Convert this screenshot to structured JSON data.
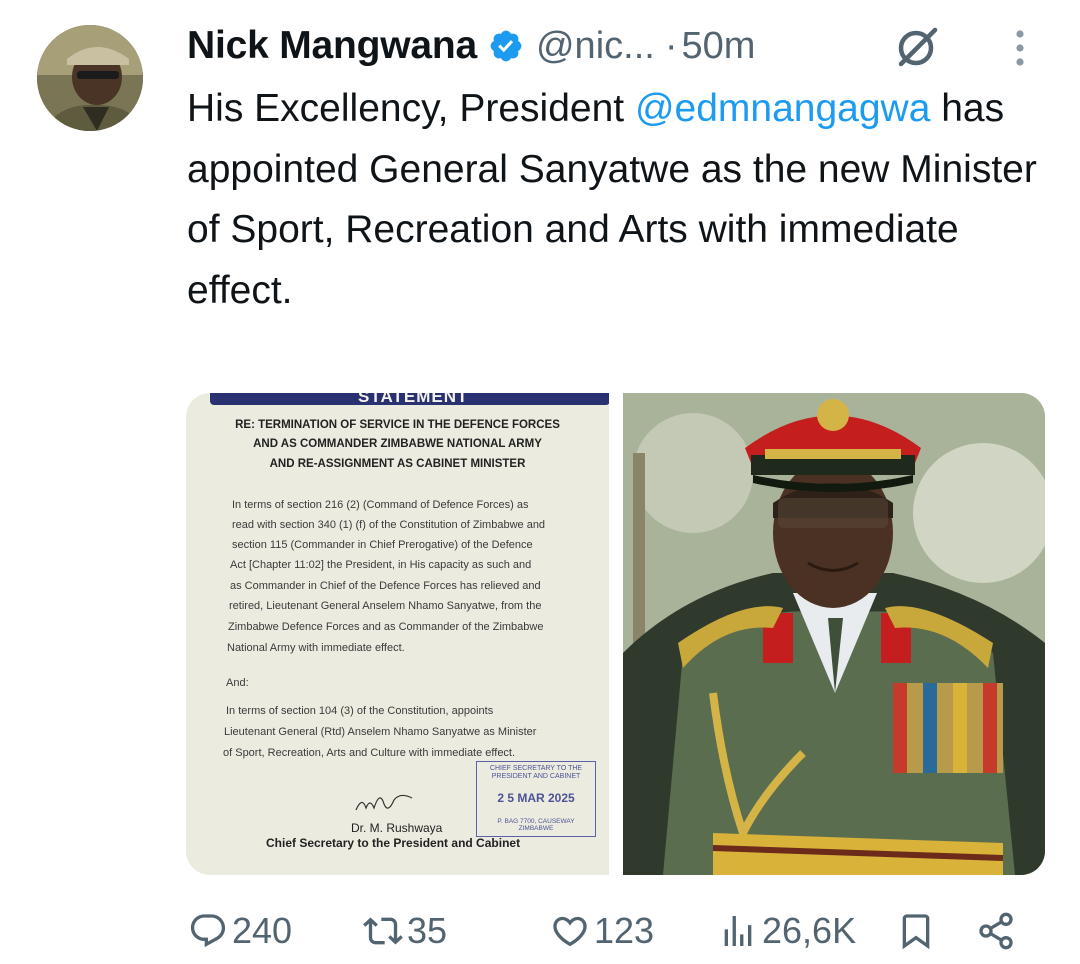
{
  "author": {
    "name": "Nick Mangwana",
    "handle": "@nic...",
    "separator": "·",
    "time": "50m"
  },
  "tweet": {
    "text_before": "His Excellency, President ",
    "mention": "@edmnangagwa",
    "text_after": " has appointed General Sanyatwe as the new Minister of Sport, Recreation and Arts with immediate effect."
  },
  "document": {
    "banner": "STATEMENT",
    "heading": [
      "RE: TERMINATION OF SERVICE IN THE DEFENCE FORCES",
      "AND AS COMMANDER ZIMBABWE NATIONAL ARMY",
      "AND RE-ASSIGNMENT AS CABINET MINISTER"
    ],
    "paragraph1": [
      "In terms of section 216 (2) (Command of Defence Forces) as",
      "read with section 340 (1) (f) of the Constitution of Zimbabwe and",
      "section 115 (Commander in Chief Prerogative) of the Defence",
      "Act [Chapter 11:02] the President, in His capacity as such and",
      "as Commander in Chief of the Defence Forces has relieved and",
      "retired, Lieutenant General Anselem Nhamo Sanyatwe, from the",
      "Zimbabwe Defence Forces and as Commander of the Zimbabwe",
      "National Army with immediate effect."
    ],
    "and_label": "And:",
    "paragraph2": [
      "In terms of section 104 (3) of the Constitution, appoints",
      "Lieutenant General (Rtd) Anselem Nhamo Sanyatwe as Minister",
      "of Sport, Recreation, Arts and Culture with immediate effect."
    ],
    "stamp": {
      "line1": "CHIEF SECRETARY TO THE",
      "line2": "PRESIDENT AND CABINET",
      "date": "2 5 MAR 2025",
      "addr1": "P. BAG 7700, CAUSEWAY",
      "addr2": "ZIMBABWE"
    },
    "signatory_name": "Dr. M. Rushwaya",
    "signatory_title": "Chief Secretary to the President and Cabinet"
  },
  "actions": {
    "replies": "240",
    "reposts": "35",
    "likes": "123",
    "views": "26,6K"
  },
  "colors": {
    "accent": "#1d9bf0",
    "muted": "#536471",
    "text": "#0f1419"
  },
  "icons": [
    "verified-badge-icon",
    "grok-icon",
    "more-options-icon",
    "reply-icon",
    "repost-icon",
    "like-icon",
    "views-icon",
    "bookmark-icon",
    "share-icon"
  ]
}
